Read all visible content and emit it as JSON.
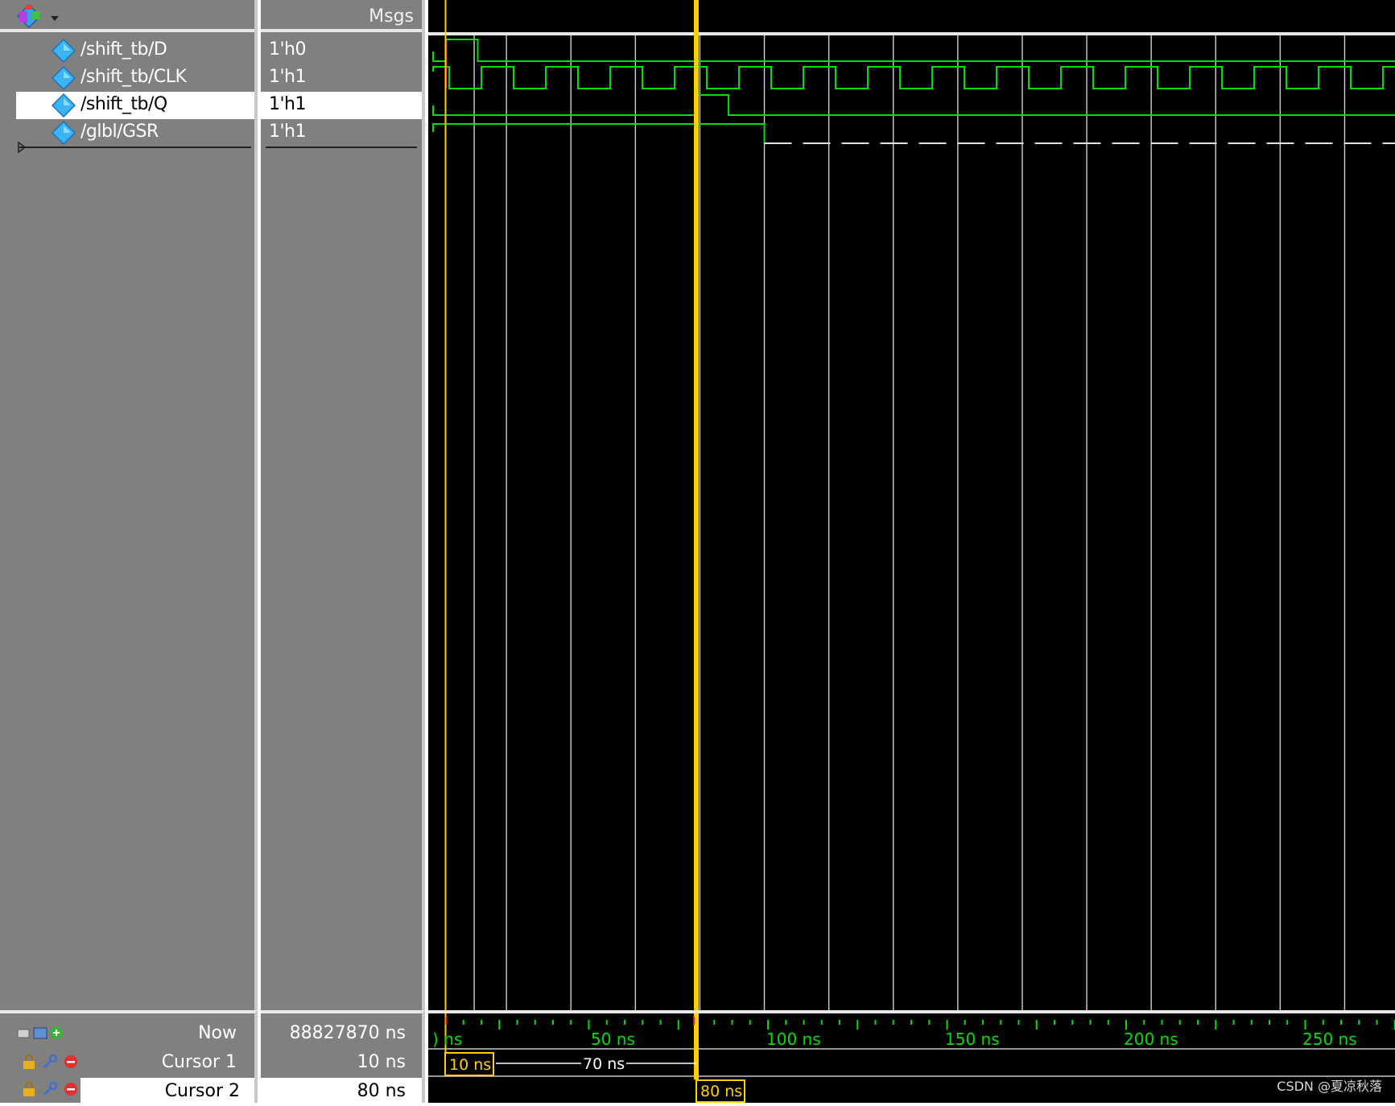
{
  "header": {
    "msgs_label": "Msgs",
    "toolbar_icon": "wave-menu-icon",
    "dropdown_icon": "chevron-down-icon"
  },
  "signals": [
    {
      "name": "/shift_tb/D",
      "value": "1'h0",
      "icon": "signal-diamond-icon"
    },
    {
      "name": "/shift_tb/CLK",
      "value": "1'h1",
      "icon": "signal-diamond-icon"
    },
    {
      "name": "/shift_tb/Q",
      "value": "1'h1",
      "icon": "signal-diamond-icon"
    },
    {
      "name": "/glbl/GSR",
      "value": "1'h1",
      "icon": "signal-diamond-icon"
    }
  ],
  "footer": {
    "now_label": "Now",
    "now_value": "88827870 ns",
    "cursor1_label": "Cursor 1",
    "cursor1_value": "10 ns",
    "cursor2_label": "Cursor 2",
    "cursor2_value": "80 ns",
    "cursor1_time_tag": "10 ns",
    "cursor2_time_tag": "80 ns",
    "cursor_delta": "70 ns"
  },
  "timeline": {
    "tick_labels": [
      ") ns",
      "50 ns",
      "100 ns",
      "150 ns",
      "200 ns",
      "250 ns"
    ]
  },
  "colors": {
    "wave": "#00e000",
    "cursor": "#ffd000",
    "grid": "#d0d0d0",
    "panel": "#808080",
    "background": "#000000"
  },
  "watermark": "CSDN @夏凉秋落"
}
